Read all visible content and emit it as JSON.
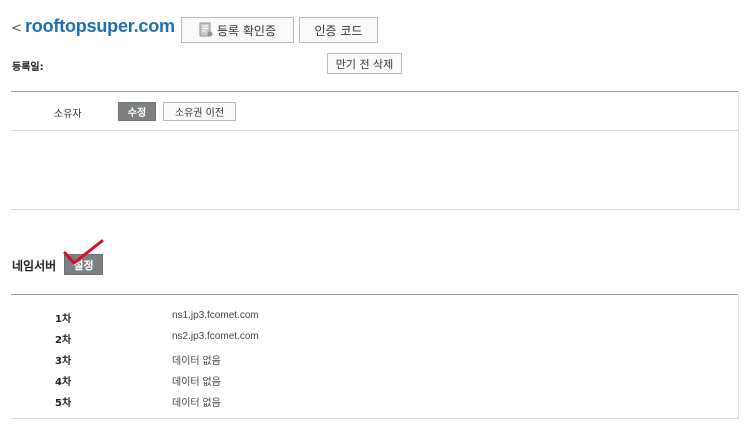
{
  "header": {
    "back_symbol": "<",
    "domain": "rooftopsuper.com",
    "cert_button_label": "등록 확인증",
    "auth_code_button_label": "인증 코드",
    "expire_delete_button_label": "만기 전 삭제",
    "registration_date_label": "등록일:"
  },
  "owner": {
    "label": "소유자",
    "edit_button_label": "수정",
    "transfer_button_label": "소유권 이전"
  },
  "nameserver": {
    "title": "네임서버",
    "set_button_label": "설정",
    "rows": [
      {
        "key": "1차",
        "value": "ns1.jp3.fcomet.com"
      },
      {
        "key": "2차",
        "value": "ns2.jp3.fcomet.com"
      },
      {
        "key": "3차",
        "value": "데이터 없음"
      },
      {
        "key": "4차",
        "value": "데이터 없음"
      },
      {
        "key": "5차",
        "value": "데이터 없음"
      }
    ]
  },
  "colors": {
    "domain": "#1c6fb6",
    "dark_button": "#7d8082",
    "checkmark": "#d0112b"
  }
}
